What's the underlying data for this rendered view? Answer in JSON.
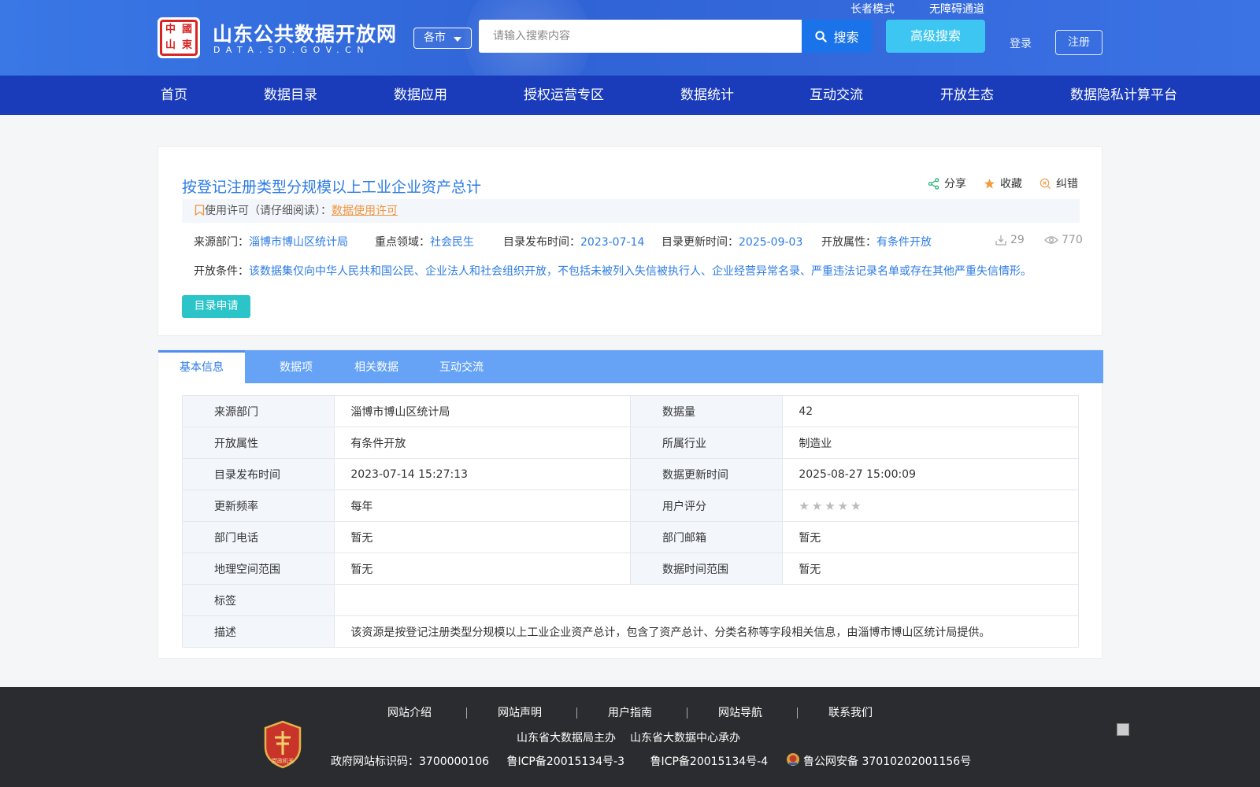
{
  "header": {
    "logo_emblem": [
      "中",
      "國",
      "山",
      "東"
    ],
    "site_title": "山东公共数据开放网",
    "site_domain": "DATA.SD.GOV.CN",
    "city_select": "各市",
    "search_placeholder": "请输入搜索内容",
    "search_label": "搜索",
    "advanced_search_label": "高级搜索",
    "elder_mode": "长者模式",
    "accessibility": "无障碍通道",
    "login": "登录",
    "register": "注册",
    "colors": {
      "header_bg": "#3a78e6",
      "nav_bg": "#1a3cba",
      "accent": "#2c7be5"
    }
  },
  "nav": {
    "items": [
      "首页",
      "数据目录",
      "数据应用",
      "授权运营专区",
      "数据统计",
      "互动交流",
      "开放生态",
      "数据隐私计算平台"
    ]
  },
  "dataset": {
    "title": "按登记注册类型分规模以上工业企业资产总计",
    "actions": {
      "share": "分享",
      "favorite": "收藏",
      "correct": "纠错"
    },
    "license_prefix": "使用许可（请仔细阅读）：",
    "license_link": "数据使用许可",
    "meta": {
      "source_label": "来源部门：",
      "source_value": "淄博市博山区统计局",
      "domain_label": "重点领域：",
      "domain_value": "社会民生",
      "publish_label": "目录发布时间：",
      "publish_value": "2023-07-14",
      "update_label": "目录更新时间：",
      "update_value": "2025-09-03",
      "open_label": "开放属性：",
      "open_value": "有条件开放",
      "downloads": "29",
      "views": "770"
    },
    "condition_label": "开放条件：",
    "condition_value": "该数据集仅向中华人民共和国公民、企业法人和社会组织开放，不包括未被列入失信被执行人、企业经营异常名录、严重违法记录名单或存在其他严重失信情形。",
    "apply_button": "目录申请"
  },
  "tabs": [
    "基本信息",
    "数据项",
    "相关数据",
    "互动交流"
  ],
  "info_table": {
    "rows": [
      {
        "k1": "来源部门",
        "v1": "淄博市博山区统计局",
        "k2": "数据量",
        "v2": "42"
      },
      {
        "k1": "开放属性",
        "v1": "有条件开放",
        "k2": "所属行业",
        "v2": "制造业"
      },
      {
        "k1": "目录发布时间",
        "v1": "2023-07-14 15:27:13",
        "k2": "数据更新时间",
        "v2": "2025-08-27 15:00:09"
      },
      {
        "k1": "更新频率",
        "v1": "每年",
        "k2": "用户评分",
        "v2": ""
      },
      {
        "k1": "部门电话",
        "v1": "暂无",
        "k2": "部门邮箱",
        "v2": "暂无"
      },
      {
        "k1": "地理空间范围",
        "v1": "暂无",
        "k2": "数据时间范围",
        "v2": "暂无"
      }
    ],
    "tags_label": "标签",
    "tags_value": "",
    "desc_label": "描述",
    "desc_value": "该资源是按登记注册类型分规模以上工业企业资产总计，包含了资产总计、分类名称等字段相关信息，由淄博市博山区统计局提供。",
    "rating_stars": 0,
    "rating_max": 5
  },
  "footer": {
    "links": [
      "网站介绍",
      "网站声明",
      "用户指南",
      "网站导航",
      "联系我们"
    ],
    "host": "山东省大数据局主办",
    "organizer": "山东省大数据中心承办",
    "gov_id": "政府网站标识码：3700000106",
    "icp1": "鲁ICP备20015134号-3",
    "icp2": "鲁ICP备20015134号-4",
    "police": "鲁公网安备 37010202001156号",
    "badge_text": "党政机关"
  }
}
